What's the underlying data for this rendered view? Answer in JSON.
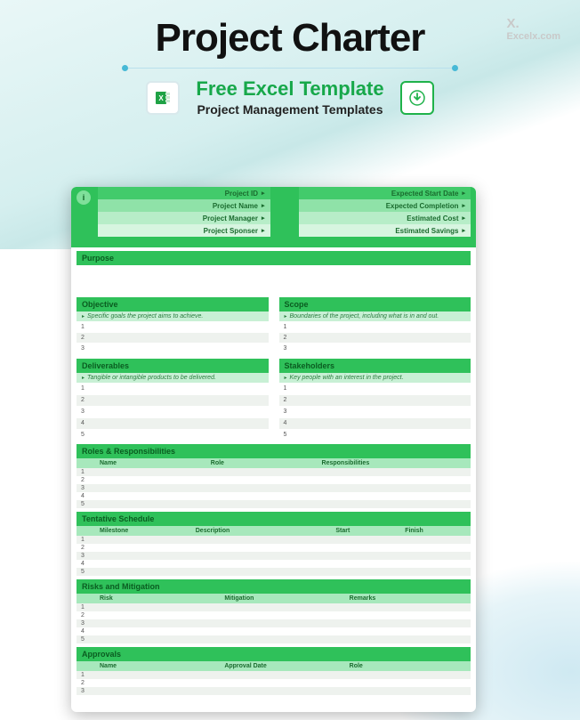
{
  "watermark": {
    "brand": "X.",
    "site": "Excelx.com"
  },
  "header": {
    "title": "Project Charter",
    "subtitle": "Free Excel Template",
    "tagline": "Project Management Templates"
  },
  "icons": {
    "excel": "excel-icon",
    "download": "download-icon"
  },
  "top": {
    "left": [
      "Project ID",
      "Project Name",
      "Project Manager",
      "Project Sponser"
    ],
    "right": [
      "Expected Start Date",
      "Expected Completion",
      "Estimated Cost",
      "Estimated Savings"
    ]
  },
  "sections": {
    "purpose": {
      "title": "Purpose"
    },
    "objective": {
      "title": "Objective",
      "hint": "Specific goals the project aims to achieve.",
      "rows": [
        "1",
        "2",
        "3"
      ]
    },
    "scope": {
      "title": "Scope",
      "hint": "Boundaries of the project, including what is in and out.",
      "rows": [
        "1",
        "2",
        "3"
      ]
    },
    "deliverables": {
      "title": "Deliverables",
      "hint": "Tangible or intangible products to be delivered.",
      "rows": [
        "1",
        "2",
        "3",
        "4",
        "5"
      ]
    },
    "stakeholders": {
      "title": "Stakeholders",
      "hint": "Key people with an interest in the project.",
      "rows": [
        "1",
        "2",
        "3",
        "4",
        "5"
      ]
    },
    "roles": {
      "title": "Roles & Responsibilities",
      "cols": [
        "Name",
        "Role",
        "Responsibilities"
      ],
      "rows": [
        "1",
        "2",
        "3",
        "4",
        "5"
      ]
    },
    "schedule": {
      "title": "Tentative Schedule",
      "cols": [
        "Milestone",
        "Description",
        "Start",
        "Finish"
      ],
      "rows": [
        "1",
        "2",
        "3",
        "4",
        "5"
      ]
    },
    "risks": {
      "title": "Risks and Mitigation",
      "cols": [
        "Risk",
        "Mitigation",
        "Remarks"
      ],
      "rows": [
        "1",
        "2",
        "3",
        "4",
        "5"
      ]
    },
    "approvals": {
      "title": "Approvals",
      "cols": [
        "Name",
        "Approval Date",
        "Role"
      ],
      "rows": [
        "1",
        "2",
        "3"
      ]
    }
  }
}
